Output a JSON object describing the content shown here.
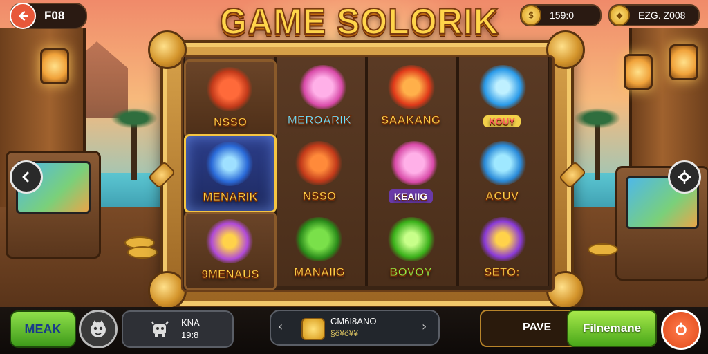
{
  "header": {
    "level": "F08",
    "title": "GAME SOLORIK",
    "coins": "159:0",
    "gems": "EZG. Z008"
  },
  "reels": [
    [
      {
        "label": "NSSO",
        "icon": "tribal-emblem-icon"
      },
      {
        "label": "MENARIK",
        "icon": "blue-gem-leaf-icon"
      },
      {
        "label": "9MENAUS",
        "icon": "purple-lotus-icon"
      }
    ],
    [
      {
        "label": "MEROARIK",
        "icon": "pink-creature-icon"
      },
      {
        "label": "NSSO",
        "icon": "tribal-emblem-icon"
      },
      {
        "label": "MANAIIG",
        "icon": "green-dragon-icon"
      }
    ],
    [
      {
        "label": "SAAKANG",
        "icon": "red-fish-icon"
      },
      {
        "label": "KEAIIG",
        "icon": "pink-creature-icon"
      },
      {
        "label": "BOVOY",
        "icon": "green-orb-icon"
      }
    ],
    [
      {
        "label": "KOUY",
        "icon": "blue-orb-feather-icon"
      },
      {
        "label": "ACUV",
        "icon": "blue-dolphin-icon"
      },
      {
        "label": "SETO:",
        "icon": "purple-orb-icon"
      }
    ]
  ],
  "bottom": {
    "back_label": "MEAK",
    "info_line1": "KNA",
    "info_line2": "19:8",
    "bet_line1": "CM6I8ANO",
    "bet_line2": "§ö¥ö¥¥",
    "pave_label": "PAVE",
    "spin_label": "Filnemane"
  },
  "colors": {
    "accent_gold": "#ffd54a",
    "spin_green": "#4aa81a",
    "back_orange": "#e8583a"
  }
}
